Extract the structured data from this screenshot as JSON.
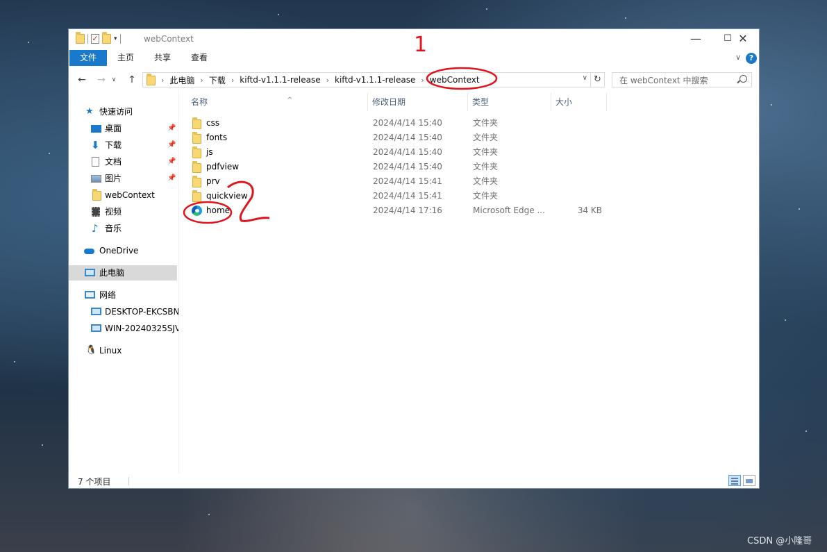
{
  "window": {
    "title": "webContext",
    "controls": {
      "minimize": "—",
      "maximize": "☐",
      "close": "✕"
    }
  },
  "ribbon": {
    "tabs": [
      "文件",
      "主页",
      "共享",
      "查看"
    ],
    "help": "?"
  },
  "navigation": {
    "breadcrumbs": [
      "此电脑",
      "下载",
      "kiftd-v1.1.1-release",
      "kiftd-v1.1.1-release",
      "webContext"
    ],
    "search_placeholder": "在 webContext 中搜索"
  },
  "sidebar": {
    "quick_access": "快速访问",
    "items": [
      {
        "label": "桌面",
        "icon": "desktop-icon",
        "pinned": true
      },
      {
        "label": "下载",
        "icon": "download-icon",
        "pinned": true
      },
      {
        "label": "文档",
        "icon": "document-icon",
        "pinned": true
      },
      {
        "label": "图片",
        "icon": "picture-icon",
        "pinned": true
      },
      {
        "label": "webContext",
        "icon": "folder-icon",
        "pinned": false
      },
      {
        "label": "视频",
        "icon": "video-icon",
        "pinned": false
      },
      {
        "label": "音乐",
        "icon": "music-icon",
        "pinned": false
      }
    ],
    "onedrive": "OneDrive",
    "this_pc": "此电脑",
    "network": "网络",
    "network_items": [
      "DESKTOP-EKCSBN",
      "WIN-20240325SJV"
    ],
    "linux": "Linux"
  },
  "columns": {
    "name": "名称",
    "date": "修改日期",
    "type": "类型",
    "size": "大小"
  },
  "files": [
    {
      "name": "css",
      "date": "2024/4/14 15:40",
      "type": "文件夹",
      "size": "",
      "icon": "folder-icon"
    },
    {
      "name": "fonts",
      "date": "2024/4/14 15:40",
      "type": "文件夹",
      "size": "",
      "icon": "folder-icon"
    },
    {
      "name": "js",
      "date": "2024/4/14 15:40",
      "type": "文件夹",
      "size": "",
      "icon": "folder-icon"
    },
    {
      "name": "pdfview",
      "date": "2024/4/14 15:40",
      "type": "文件夹",
      "size": "",
      "icon": "folder-icon"
    },
    {
      "name": "prv",
      "date": "2024/4/14 15:41",
      "type": "文件夹",
      "size": "",
      "icon": "folder-icon"
    },
    {
      "name": "quickview",
      "date": "2024/4/14 15:41",
      "type": "文件夹",
      "size": "",
      "icon": "folder-icon"
    },
    {
      "name": "home",
      "date": "2024/4/14 17:16",
      "type": "Microsoft Edge ...",
      "size": "34 KB",
      "icon": "edge-icon"
    }
  ],
  "status": {
    "count": "7 个项目"
  },
  "annotations": {
    "mark1": "1",
    "mark2": "2"
  },
  "watermark": "CSDN @小隆哥",
  "colors": {
    "accent": "#1979ca",
    "annotation_red": "#e0141c",
    "selected_bg": "#d9d9d9"
  }
}
